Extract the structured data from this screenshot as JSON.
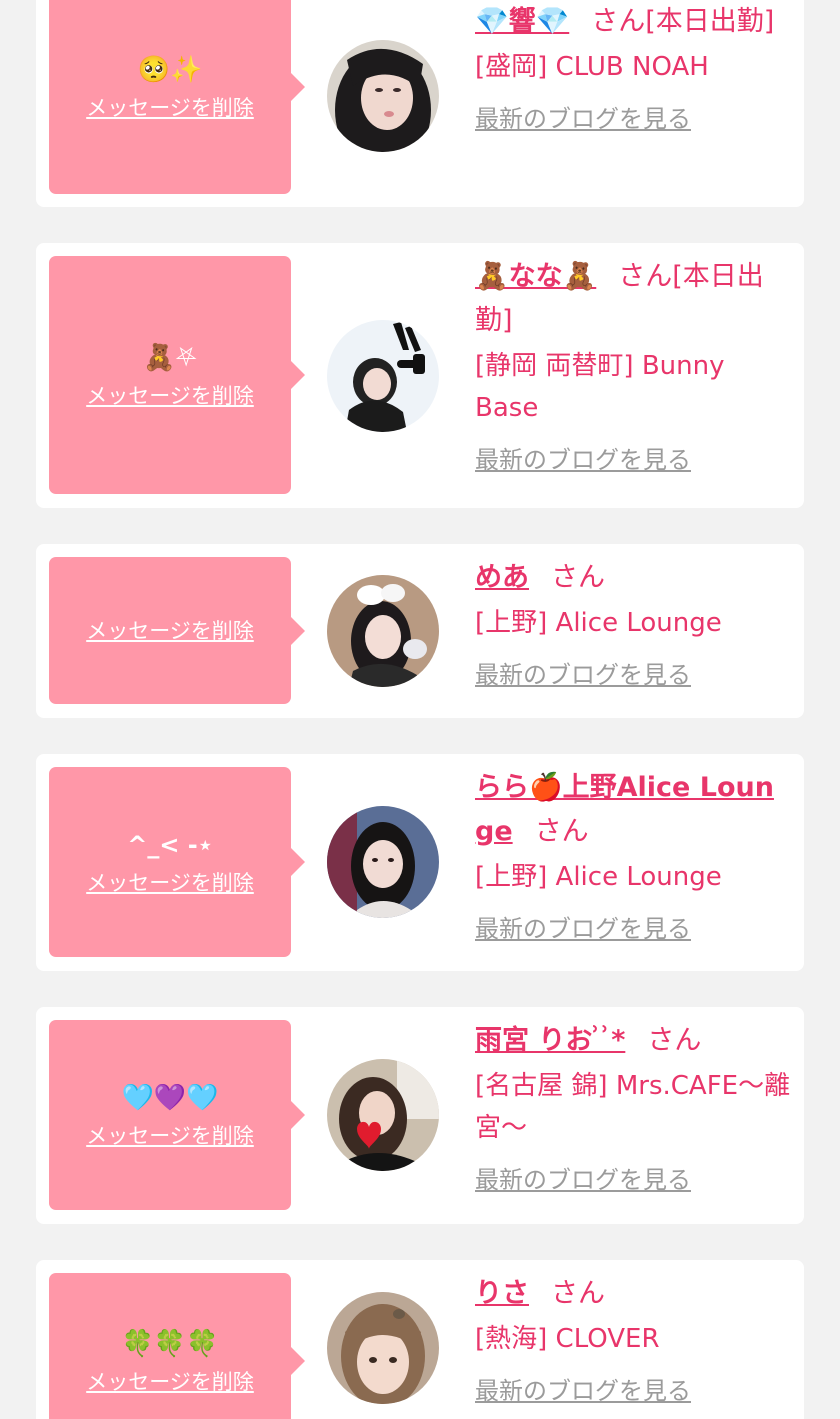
{
  "accent_color": "#e8356a",
  "bubble_color": "#ff97a8",
  "cards": [
    {
      "message": "🥺✨",
      "delete_label": "メッセージを削除",
      "name": "💎響💎",
      "san": "さん",
      "status": "[本日出勤]",
      "shop": "[盛岡] CLUB NOAH",
      "blog_label": "最新のブログを見る"
    },
    {
      "message": "🧸⛧",
      "delete_label": "メッセージを削除",
      "name": "🧸なな🧸",
      "san": "さん",
      "status": "[本日出勤]",
      "shop": "[静岡 両替町] Bunny Base",
      "blog_label": "最新のブログを見る"
    },
    {
      "message": "",
      "delete_label": "メッセージを削除",
      "name": "めあ",
      "san": "さん",
      "status": "",
      "shop": "[上野] Alice Lounge",
      "blog_label": "最新のブログを見る"
    },
    {
      "message": "^_< -⋆",
      "delete_label": "メッセージを削除",
      "name": "らら🍎上野Alice Lounge",
      "san": "さん",
      "status": "",
      "shop": "[上野] Alice Lounge",
      "blog_label": "最新のブログを見る"
    },
    {
      "message": "🩵💜🩵",
      "delete_label": "メッセージを削除",
      "name": "雨宮 りお ͗ ͗*",
      "san": "さん",
      "status": "",
      "shop": "[名古屋 錦] Mrs.CAFE〜離宮〜",
      "blog_label": "最新のブログを見る"
    },
    {
      "message": "🍀🍀🍀",
      "delete_label": "メッセージを削除",
      "name": "りさ",
      "san": "さん",
      "status": "",
      "shop": "[熱海] CLOVER",
      "blog_label": "最新のブログを見る"
    }
  ]
}
